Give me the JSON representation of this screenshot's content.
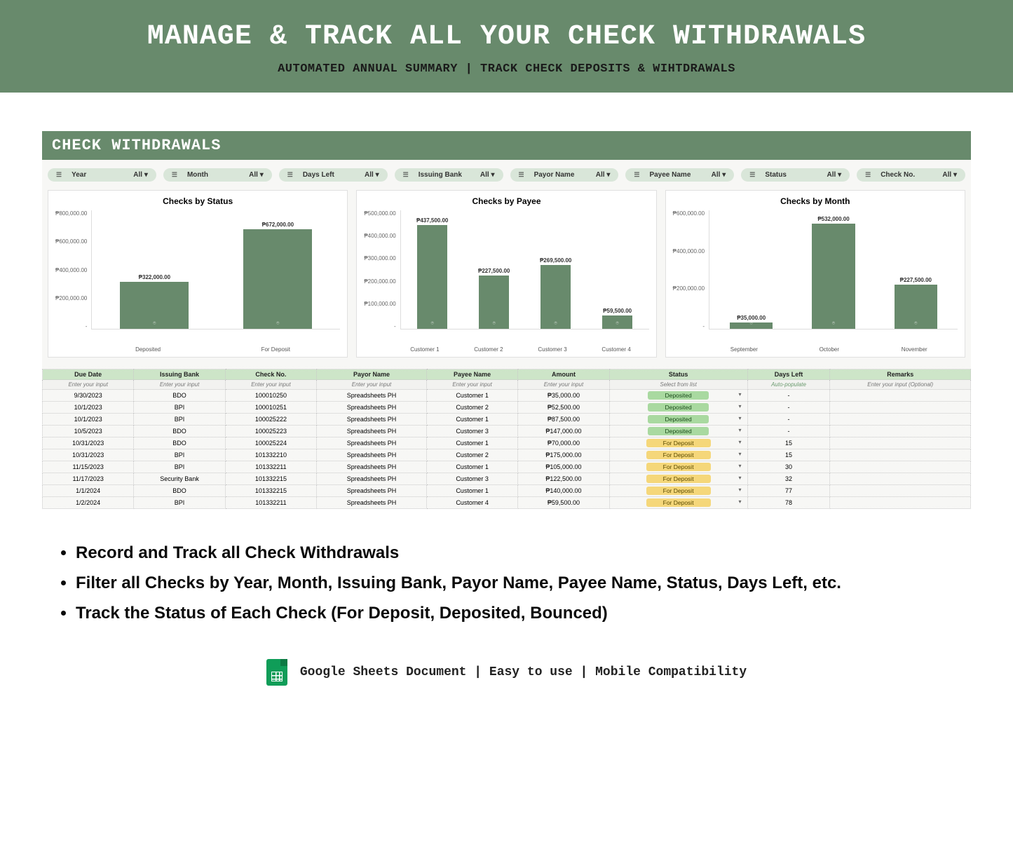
{
  "banner": {
    "title": "MANAGE & TRACK ALL YOUR CHECK WITHDRAWALS",
    "subtitle": "AUTOMATED ANNUAL SUMMARY | TRACK CHECK DEPOSITS & WIHTDRAWALS"
  },
  "sheet": {
    "title": "CHECK WITHDRAWALS"
  },
  "filters": [
    {
      "label": "Year",
      "value": "All ▾"
    },
    {
      "label": "Month",
      "value": "All ▾"
    },
    {
      "label": "Days Left",
      "value": "All ▾"
    },
    {
      "label": "Issuing Bank",
      "value": "All ▾"
    },
    {
      "label": "Payor Name",
      "value": "All ▾"
    },
    {
      "label": "Payee Name",
      "value": "All ▾"
    },
    {
      "label": "Status",
      "value": "All ▾"
    },
    {
      "label": "Check No.",
      "value": "All ▾"
    }
  ],
  "chart_data": [
    {
      "type": "bar",
      "title": "Checks by Status",
      "categories": [
        "Deposited",
        "For Deposit"
      ],
      "values": [
        322000,
        672000
      ],
      "value_labels": [
        "₱322,000.00",
        "₱672,000.00"
      ],
      "yticks": [
        "₱800,000.00",
        "₱600,000.00",
        "₱400,000.00",
        "₱200,000.00",
        "-"
      ],
      "ymax": 800000
    },
    {
      "type": "bar",
      "title": "Checks by Payee",
      "categories": [
        "Customer 1",
        "Customer 2",
        "Customer 3",
        "Customer 4"
      ],
      "values": [
        437500,
        227500,
        269500,
        59500
      ],
      "value_labels": [
        "₱437,500.00",
        "₱227,500.00",
        "₱269,500.00",
        "₱59,500.00"
      ],
      "yticks": [
        "₱500,000.00",
        "₱400,000.00",
        "₱300,000.00",
        "₱200,000.00",
        "₱100,000.00",
        "-"
      ],
      "ymax": 500000
    },
    {
      "type": "bar",
      "title": "Checks by Month",
      "categories": [
        "September",
        "October",
        "November"
      ],
      "values": [
        35000,
        532000,
        227500
      ],
      "value_labels": [
        "₱35,000.00",
        "₱532,000.00",
        "₱227,500.00"
      ],
      "yticks": [
        "₱600,000.00",
        "₱400,000.00",
        "₱200,000.00",
        "-"
      ],
      "ymax": 600000
    }
  ],
  "table": {
    "hints": [
      "Enter your input",
      "Enter your input",
      "Enter your input",
      "Enter your input",
      "Enter your input",
      "Enter your input",
      "Select from list",
      "Auto-populate",
      "Enter your input (Optional)"
    ],
    "headers": [
      "Due Date",
      "Issuing Bank",
      "Check No.",
      "Payor Name",
      "Payee Name",
      "Amount",
      "Status",
      "Days Left",
      "Remarks"
    ],
    "rows": [
      {
        "c": [
          "9/30/2023",
          "BDO",
          "100010250",
          "Spreadsheets PH",
          "Customer 1",
          "₱35,000.00",
          "Deposited",
          "-",
          ""
        ]
      },
      {
        "c": [
          "10/1/2023",
          "BPI",
          "100010251",
          "Spreadsheets PH",
          "Customer 2",
          "₱52,500.00",
          "Deposited",
          "-",
          ""
        ]
      },
      {
        "c": [
          "10/1/2023",
          "BPI",
          "100025222",
          "Spreadsheets PH",
          "Customer 1",
          "₱87,500.00",
          "Deposited",
          "-",
          ""
        ]
      },
      {
        "c": [
          "10/5/2023",
          "BDO",
          "100025223",
          "Spreadsheets PH",
          "Customer 3",
          "₱147,000.00",
          "Deposited",
          "-",
          ""
        ]
      },
      {
        "c": [
          "10/31/2023",
          "BDO",
          "100025224",
          "Spreadsheets PH",
          "Customer 1",
          "₱70,000.00",
          "For Deposit",
          "15",
          ""
        ]
      },
      {
        "c": [
          "10/31/2023",
          "BPI",
          "101332210",
          "Spreadsheets PH",
          "Customer 2",
          "₱175,000.00",
          "For Deposit",
          "15",
          ""
        ]
      },
      {
        "c": [
          "11/15/2023",
          "BPI",
          "101332211",
          "Spreadsheets PH",
          "Customer 1",
          "₱105,000.00",
          "For Deposit",
          "30",
          ""
        ]
      },
      {
        "c": [
          "11/17/2023",
          "Security Bank",
          "101332215",
          "Spreadsheets PH",
          "Customer 3",
          "₱122,500.00",
          "For Deposit",
          "32",
          ""
        ]
      },
      {
        "c": [
          "1/1/2024",
          "BDO",
          "101332215",
          "Spreadsheets PH",
          "Customer 1",
          "₱140,000.00",
          "For Deposit",
          "77",
          ""
        ]
      },
      {
        "c": [
          "1/2/2024",
          "BPI",
          "101332211",
          "Spreadsheets PH",
          "Customer 4",
          "₱59,500.00",
          "For Deposit",
          "78",
          ""
        ]
      }
    ]
  },
  "bullets": [
    "Record and Track all Check Withdrawals",
    "Filter all Checks by Year, Month, Issuing Bank, Payor Name, Payee Name, Status, Days Left, etc.",
    "Track the Status of Each Check (For Deposit, Deposited, Bounced)"
  ],
  "footer": {
    "text": "Google Sheets Document  | Easy to use | Mobile Compatibility"
  }
}
